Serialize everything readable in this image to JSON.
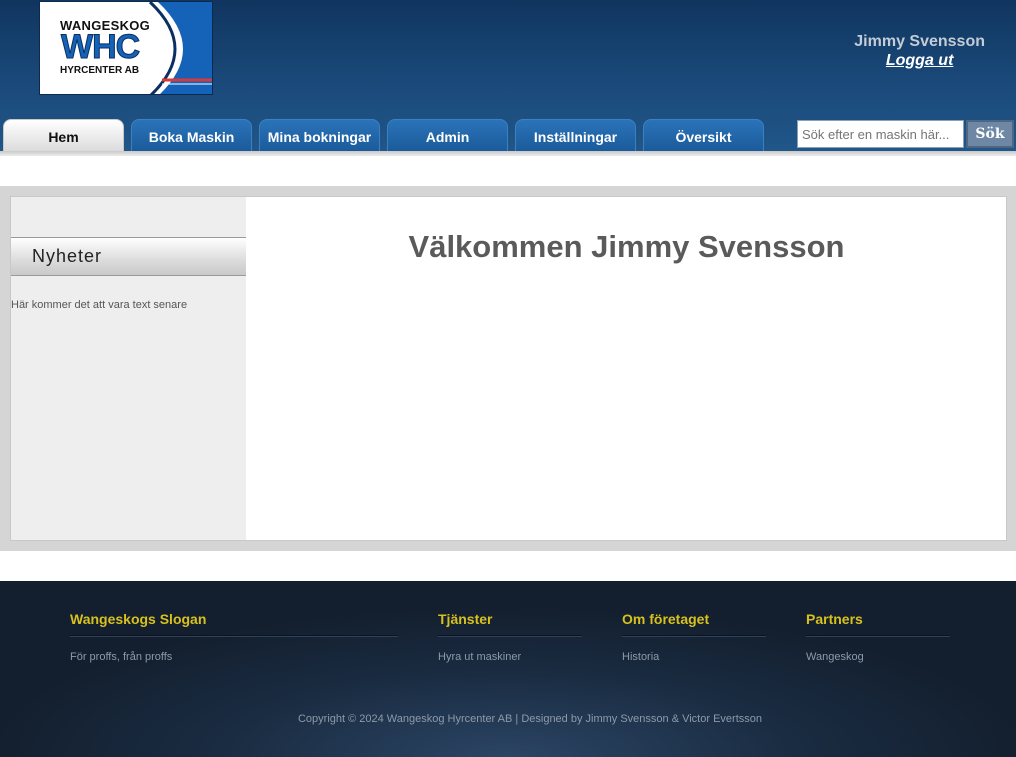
{
  "header": {
    "logo": {
      "line1": "WANGESKOG",
      "line2": "WHC",
      "line3": "HYRCENTER AB"
    },
    "user_name": "Jimmy Svensson",
    "logout_label": "Logga ut"
  },
  "nav": {
    "tabs": [
      {
        "label": "Hem",
        "active": true
      },
      {
        "label": "Boka Maskin",
        "active": false
      },
      {
        "label": "Mina bokningar",
        "active": false
      },
      {
        "label": "Admin",
        "active": false
      },
      {
        "label": "Inställningar",
        "active": false
      },
      {
        "label": "Översikt",
        "active": false
      }
    ],
    "search": {
      "placeholder": "Sök efter en maskin här...",
      "button_label": "Sök"
    }
  },
  "sidebar": {
    "heading": "Nyheter",
    "text": "Här kommer det att vara text senare"
  },
  "main": {
    "welcome": "Välkommen Jimmy Svensson"
  },
  "footer": {
    "columns": [
      {
        "heading": "Wangeskogs Slogan",
        "text": "För proffs, från proffs"
      },
      {
        "heading": "Tjänster",
        "text": "Hyra ut maskiner"
      },
      {
        "heading": "Om företaget",
        "text": "Historia"
      },
      {
        "heading": "Partners",
        "text": "Wangeskog"
      }
    ],
    "copyright": "Copyright © 2024 Wangeskog Hyrcenter AB | Designed by Jimmy Svensson & Victor Evertsson"
  },
  "colors": {
    "header_blue": "#1b4b7c",
    "tab_blue": "#2a73b8",
    "footer_heading": "#d8c11d",
    "footer_bg": "#1a2c42"
  }
}
